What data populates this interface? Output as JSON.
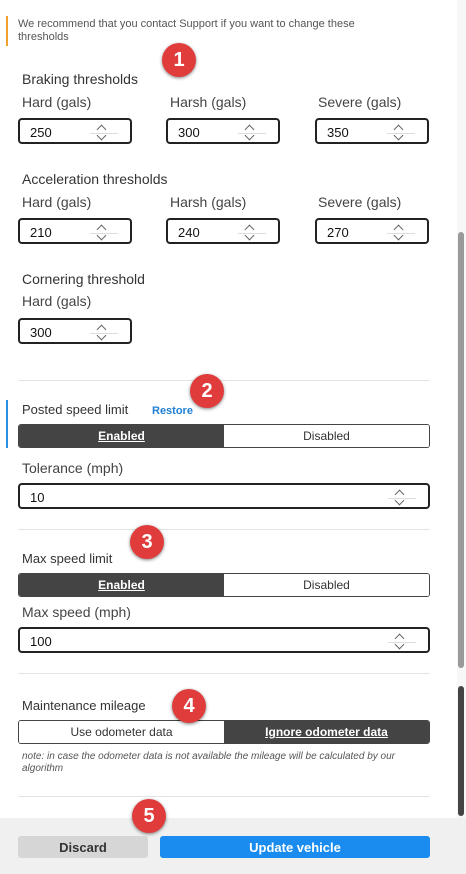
{
  "notice": "We recommend that you contact Support if you want to change these thresholds",
  "braking": {
    "title": "Braking thresholds",
    "fields": [
      {
        "label": "Hard (gals)",
        "value": "250"
      },
      {
        "label": "Harsh (gals)",
        "value": "300"
      },
      {
        "label": "Severe (gals)",
        "value": "350"
      }
    ]
  },
  "acceleration": {
    "title": "Acceleration thresholds",
    "fields": [
      {
        "label": "Hard (gals)",
        "value": "210"
      },
      {
        "label": "Harsh (gals)",
        "value": "240"
      },
      {
        "label": "Severe (gals)",
        "value": "270"
      }
    ]
  },
  "cornering": {
    "title": "Cornering threshold",
    "fields": [
      {
        "label": "Hard (gals)",
        "value": "300"
      }
    ]
  },
  "posted_speed": {
    "title": "Posted speed limit",
    "restore": "Restore",
    "enabled": "Enabled",
    "disabled": "Disabled",
    "tolerance_label": "Tolerance (mph)",
    "tolerance_value": "10"
  },
  "max_speed": {
    "title": "Max speed limit",
    "enabled": "Enabled",
    "disabled": "Disabled",
    "field_label": "Max speed (mph)",
    "field_value": "100"
  },
  "maintenance": {
    "title": "Maintenance mileage",
    "use": "Use odometer data",
    "ignore": "Ignore odometer data",
    "note": "note: in case the odometer data is not available the mileage will be calculated by our algorithm"
  },
  "buttons": {
    "discard": "Discard",
    "update": "Update vehicle"
  },
  "badges": [
    "1",
    "2",
    "3",
    "4",
    "5"
  ],
  "colors": {
    "accent": "#1a8cf0",
    "badge": "#e03c3c",
    "notice": "#f0a030",
    "toggle_active": "#444444"
  }
}
